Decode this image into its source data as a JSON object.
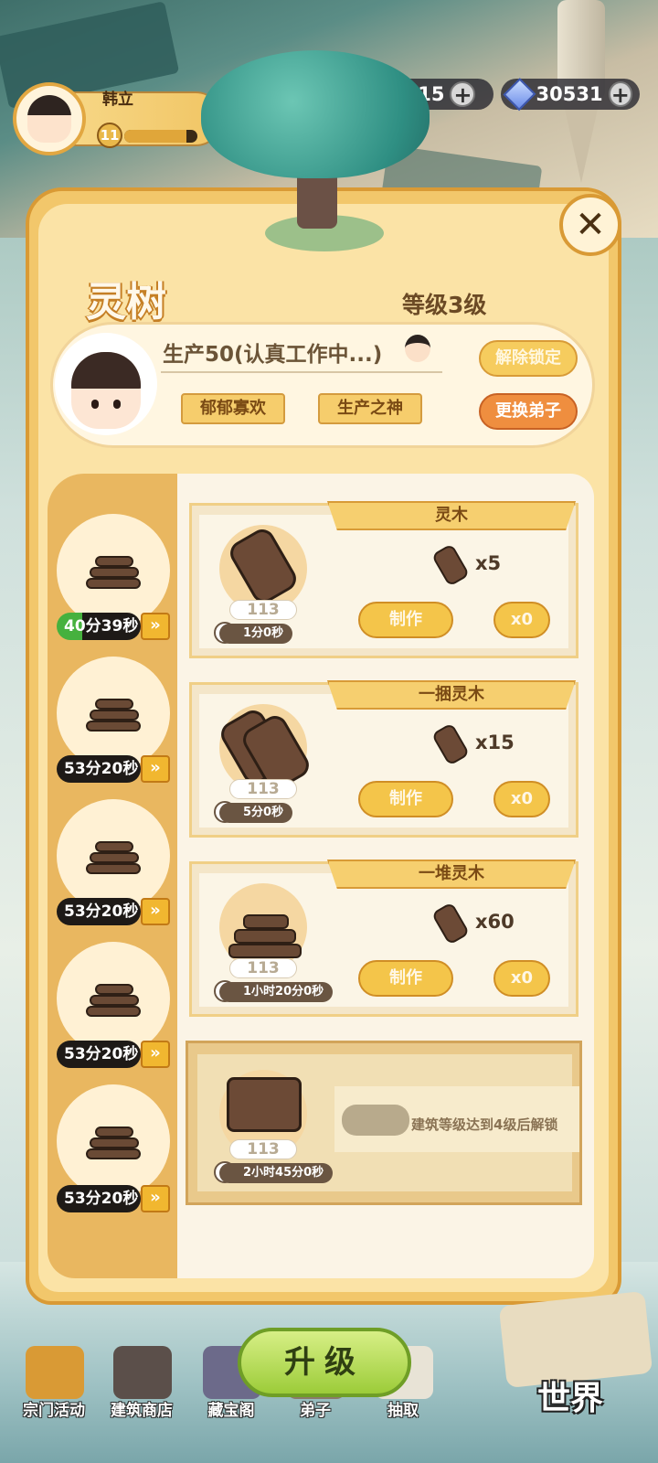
{
  "player": {
    "name": "韩立",
    "level": "11",
    "xp_fraction": 0.85
  },
  "currencies": [
    {
      "value": "8115",
      "plus": "+"
    },
    {
      "value": "30531",
      "plus": "+"
    }
  ],
  "panel": {
    "title": "灵树",
    "level_text": "等级3级",
    "close_label": "✕"
  },
  "disciple": {
    "production": "生产50(认真工作中...)",
    "traits": [
      "郁郁寡欢",
      "生产之神"
    ],
    "unlock_button": "解除锁定",
    "swap_button": "更换弟子"
  },
  "queue": [
    {
      "timer": "40分39秒",
      "active": true,
      "speed": "»"
    },
    {
      "timer": "53分20秒",
      "active": false,
      "speed": "»"
    },
    {
      "timer": "53分20秒",
      "active": false,
      "speed": "»"
    },
    {
      "timer": "53分20秒",
      "active": false,
      "speed": "»"
    },
    {
      "timer": "53分20秒",
      "active": false,
      "speed": "»"
    }
  ],
  "recipes": [
    {
      "name": "灵木",
      "stock": "113",
      "time": "1分0秒",
      "reward_qty": "x5",
      "make_label": "制作",
      "count": "x0"
    },
    {
      "name": "一捆灵木",
      "stock": "113",
      "time": "5分0秒",
      "reward_qty": "x15",
      "make_label": "制作",
      "count": "x0"
    },
    {
      "name": "一堆灵木",
      "stock": "113",
      "time": "1小时20分0秒",
      "reward_qty": "x60",
      "make_label": "制作",
      "count": "x0"
    }
  ],
  "locked_recipe": {
    "stock": "113",
    "time": "2小时45分0秒",
    "message": "建筑等级达到4级后解锁"
  },
  "bottom_nav": {
    "upgrade": "升级",
    "items": [
      "宗门活动",
      "建筑商店",
      "藏宝阁",
      "弟子",
      "抽取"
    ],
    "world": "世界"
  },
  "colors": {
    "accent": "#f2c76b",
    "panel_border": "#d99a35",
    "upgrade": "#9ccc39"
  }
}
